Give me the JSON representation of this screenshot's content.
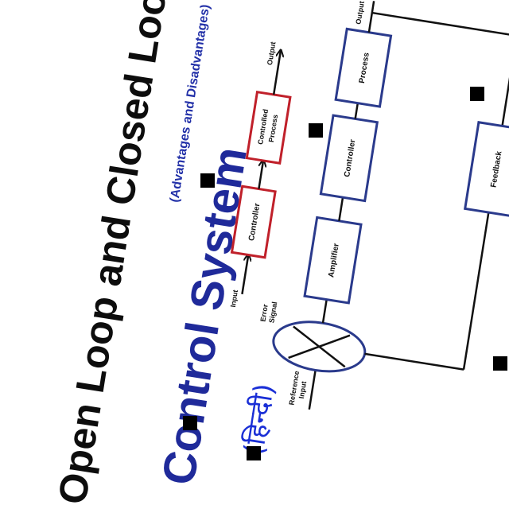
{
  "title": {
    "line1": "Open Loop and Closed Loop",
    "line2": "Control System",
    "subtitle": "(Advantages and Disadvantages)",
    "hindi": "(हिन्दी)"
  },
  "open_loop": {
    "input_label": "Input",
    "controller_label": "Controller",
    "process_label_1": "Controlled",
    "process_label_2": "Process",
    "output_label": "Output"
  },
  "closed_loop": {
    "reference_label_1": "Reference",
    "reference_label_2": "Input",
    "error_label_1": "Error",
    "error_label_2": "Signal",
    "amplifier_label": "Amplifier",
    "controller_label": "Controller",
    "process_label": "Process",
    "output_label": "Output",
    "feedback_label": "Feedback"
  },
  "colors": {
    "title_line1": "#0d0d0d",
    "title_line2": "#1f2a9a",
    "subtitle": "#2331a8",
    "hindi": "#1a2fd6",
    "open_box": "#c0202a",
    "closed_box": "#2a3a8c",
    "line": "#111111"
  }
}
